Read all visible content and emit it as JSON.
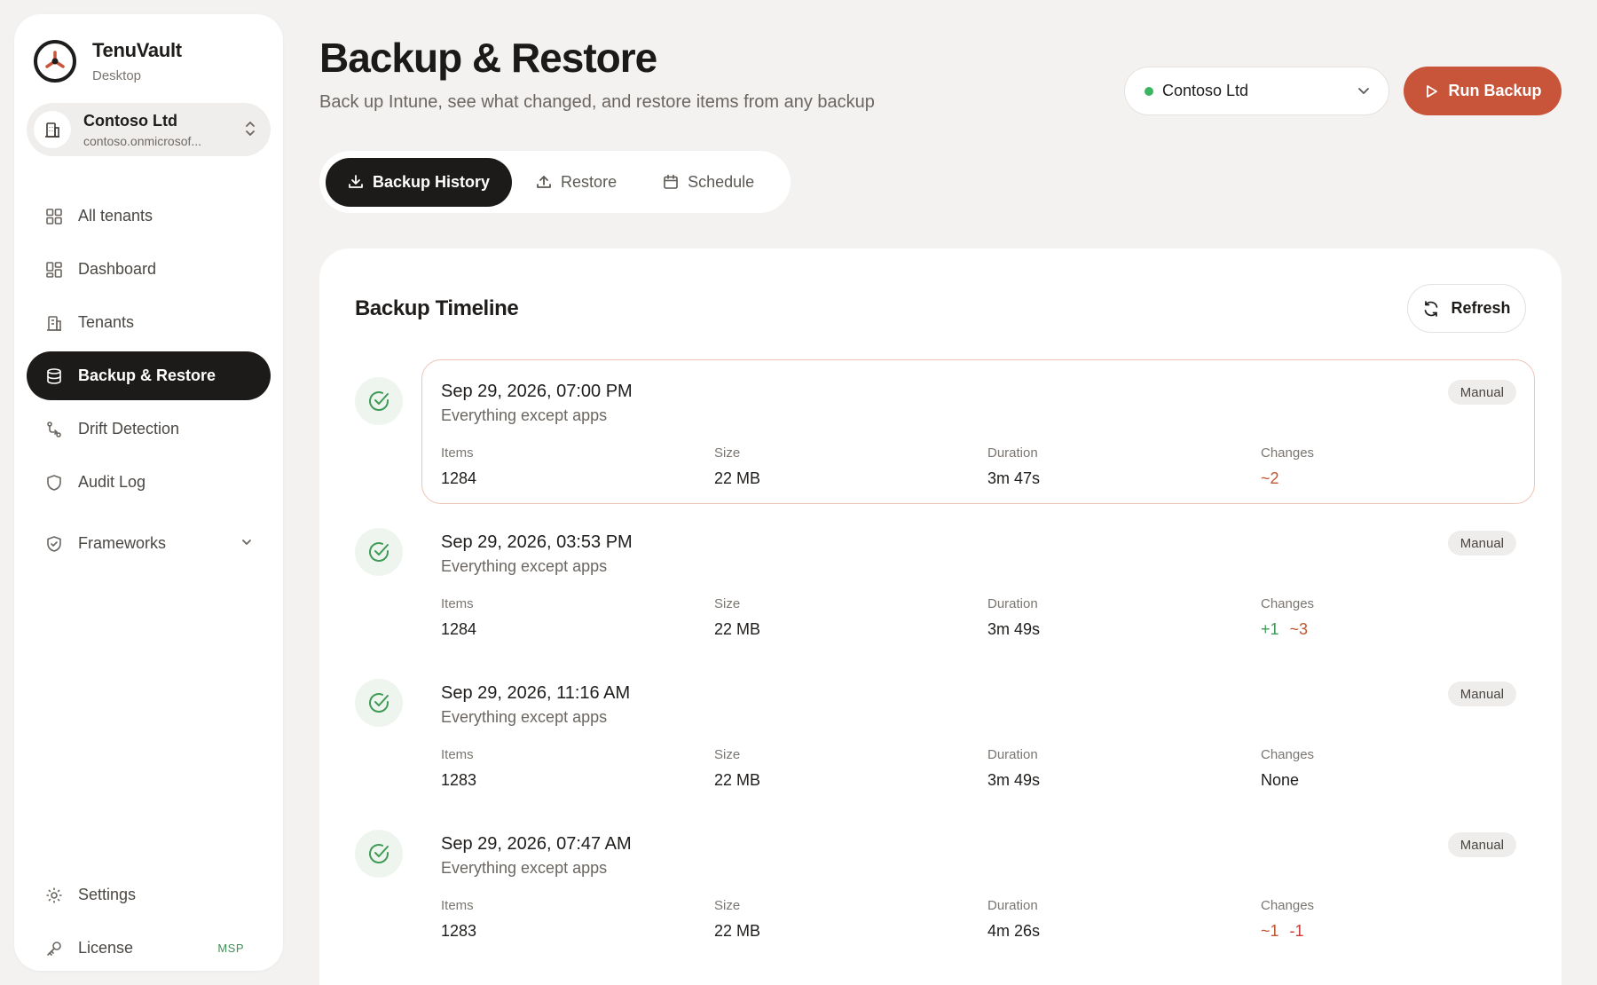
{
  "brand": {
    "name": "TenuVault",
    "subtitle": "Desktop"
  },
  "tenant_switcher": {
    "name": "Contoso Ltd",
    "domain": "contoso.onmicrosof..."
  },
  "nav": {
    "items": [
      {
        "label": "All tenants",
        "icon": "grid-icon",
        "active": false
      },
      {
        "label": "Dashboard",
        "icon": "dashboard-icon",
        "active": false
      },
      {
        "label": "Tenants",
        "icon": "building-icon",
        "active": false
      },
      {
        "label": "Backup & Restore",
        "icon": "database-icon",
        "active": true
      },
      {
        "label": "Drift Detection",
        "icon": "git-compare-icon",
        "active": false
      },
      {
        "label": "Audit Log",
        "icon": "shield-icon",
        "active": false
      },
      {
        "label": "Frameworks",
        "icon": "shield-check-icon",
        "active": false
      }
    ],
    "bottom": [
      {
        "label": "Settings",
        "icon": "gear-icon"
      },
      {
        "label": "License",
        "icon": "key-icon",
        "badge": "MSP"
      }
    ]
  },
  "header": {
    "title": "Backup & Restore",
    "subtitle": "Back up Intune, see what changed, and restore items from any backup",
    "tenant_select": "Contoso Ltd",
    "run_button": "Run Backup"
  },
  "tabs": [
    {
      "label": "Backup History",
      "icon": "download-icon",
      "active": true
    },
    {
      "label": "Restore",
      "icon": "upload-icon",
      "active": false
    },
    {
      "label": "Schedule",
      "icon": "calendar-icon",
      "active": false
    }
  ],
  "timeline": {
    "title": "Backup Timeline",
    "refresh_label": "Refresh",
    "labels": {
      "items": "Items",
      "size": "Size",
      "duration": "Duration",
      "changes": "Changes"
    },
    "entries": [
      {
        "date": "Sep 29, 2026, 07:00 PM",
        "scope": "Everything except apps",
        "tag": "Manual",
        "items": "1284",
        "size": "22 MB",
        "duration": "3m 47s",
        "changes_mod": "~2",
        "changes_add": "",
        "changes_del": "",
        "changes_none": ""
      },
      {
        "date": "Sep 29, 2026, 03:53 PM",
        "scope": "Everything except apps",
        "tag": "Manual",
        "items": "1284",
        "size": "22 MB",
        "duration": "3m 49s",
        "changes_add": "+1",
        "changes_mod": "~3",
        "changes_del": "",
        "changes_none": ""
      },
      {
        "date": "Sep 29, 2026, 11:16 AM",
        "scope": "Everything except apps",
        "tag": "Manual",
        "items": "1283",
        "size": "22 MB",
        "duration": "3m 49s",
        "changes_add": "",
        "changes_mod": "",
        "changes_del": "",
        "changes_none": "None"
      },
      {
        "date": "Sep 29, 2026, 07:47 AM",
        "scope": "Everything except apps",
        "tag": "Manual",
        "items": "1283",
        "size": "22 MB",
        "duration": "4m 26s",
        "changes_add": "",
        "changes_mod": "~1",
        "changes_del": "-1",
        "changes_none": ""
      }
    ]
  },
  "colors": {
    "accent": "#c8553a",
    "active_nav": "#1d1b1a",
    "success": "#3f9a56",
    "modified": "#c0562f",
    "deleted": "#c93b3b"
  }
}
